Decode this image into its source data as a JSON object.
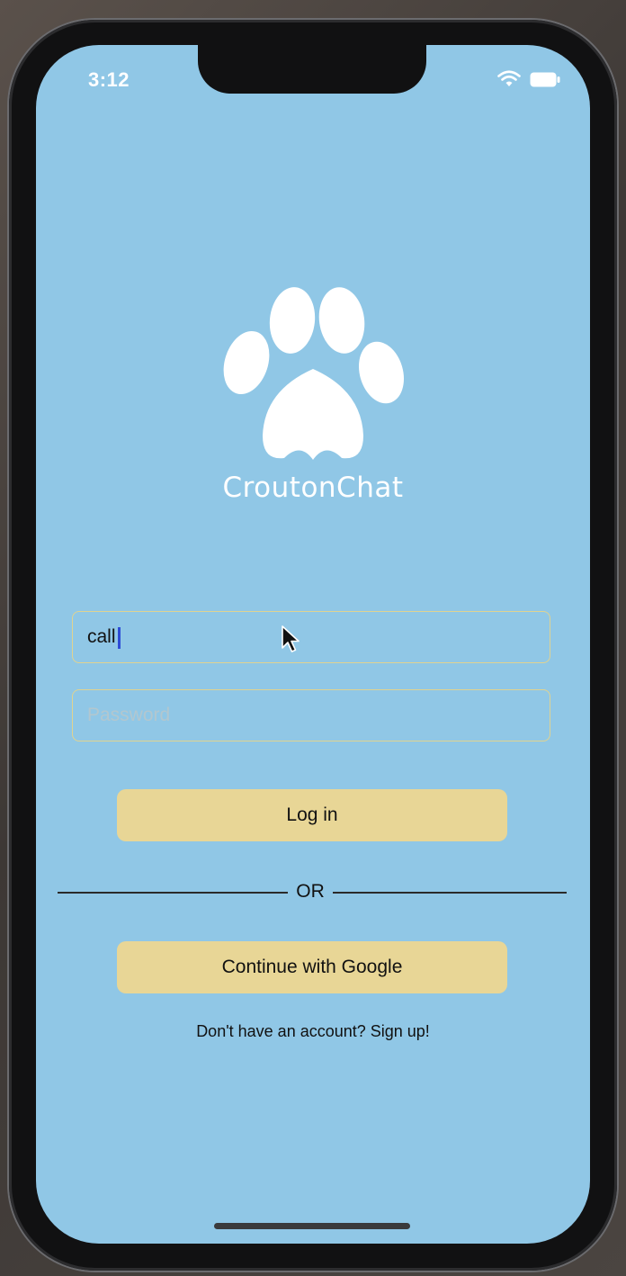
{
  "status_bar": {
    "time": "3:12",
    "wifi_icon": "wifi-icon",
    "battery_icon": "battery-icon"
  },
  "brand": {
    "logo_icon": "paw-print-icon",
    "name": "CroutonChat"
  },
  "login_form": {
    "username_value": "call",
    "password_placeholder": "Password",
    "login_label": "Log in",
    "divider_text": "OR",
    "google_label": "Continue with Google",
    "signup_text": "Don't have an account? Sign up!"
  },
  "colors": {
    "background": "#90c7e6",
    "button": "#e8d696",
    "field_border": "#e0d390"
  }
}
